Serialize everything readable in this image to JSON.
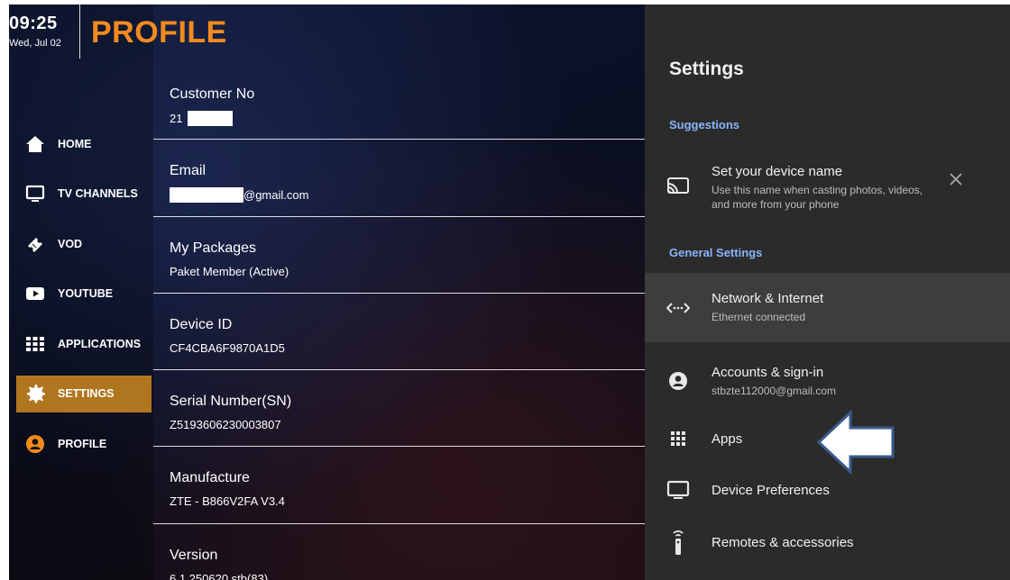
{
  "clock": {
    "time": "09:25",
    "date": "Wed, Jul 02"
  },
  "page_title": "PROFILE",
  "nav": [
    {
      "label": "HOME",
      "icon": "home-icon",
      "active": false
    },
    {
      "label": "TV CHANNELS",
      "icon": "tv-icon",
      "active": false
    },
    {
      "label": "VOD",
      "icon": "ticket-icon",
      "active": false
    },
    {
      "label": "YOUTUBE",
      "icon": "youtube-icon",
      "active": false
    },
    {
      "label": "APPLICATIONS",
      "icon": "apps-grid-icon",
      "active": false
    },
    {
      "label": "SETTINGS",
      "icon": "gear-icon",
      "active": true
    },
    {
      "label": "PROFILE",
      "icon": "user-icon",
      "active": false
    }
  ],
  "profile": {
    "customer_no": {
      "label": "Customer No",
      "value": "21"
    },
    "email": {
      "label": "Email",
      "value": "@gmail.com"
    },
    "packages": {
      "label": "My Packages",
      "value": "Paket Member (Active)"
    },
    "device_id": {
      "label": "Device ID",
      "value": "CF4CBA6F9870A1D5"
    },
    "serial": {
      "label": "Serial Number(SN)",
      "value": "Z5193606230003807"
    },
    "manufacture": {
      "label": "Manufacture",
      "value": "ZTE - B866V2FA V3.4"
    },
    "version": {
      "label": "Version",
      "value": "6.1.250620.stb(83)"
    }
  },
  "settings": {
    "title": "Settings",
    "suggestions_header": "Suggestions",
    "suggestion": {
      "title": "Set your device name",
      "subtitle": "Use this name when casting photos, videos, and more from your phone"
    },
    "general_header": "General Settings",
    "network": {
      "title": "Network & Internet",
      "subtitle": "Ethernet connected"
    },
    "accounts": {
      "title": "Accounts & sign-in",
      "subtitle": "stbzte112000@gmail.com"
    },
    "apps": {
      "title": "Apps"
    },
    "device_prefs": {
      "title": "Device Preferences"
    },
    "remotes": {
      "title": "Remotes & accessories"
    }
  },
  "colors": {
    "accent_orange": "#f28a1e",
    "nav_active": "#b0761f",
    "panel_bg": "#2b2b2b",
    "section_blue": "#8ab4f8",
    "arrow_outline": "#3a5a8c"
  }
}
